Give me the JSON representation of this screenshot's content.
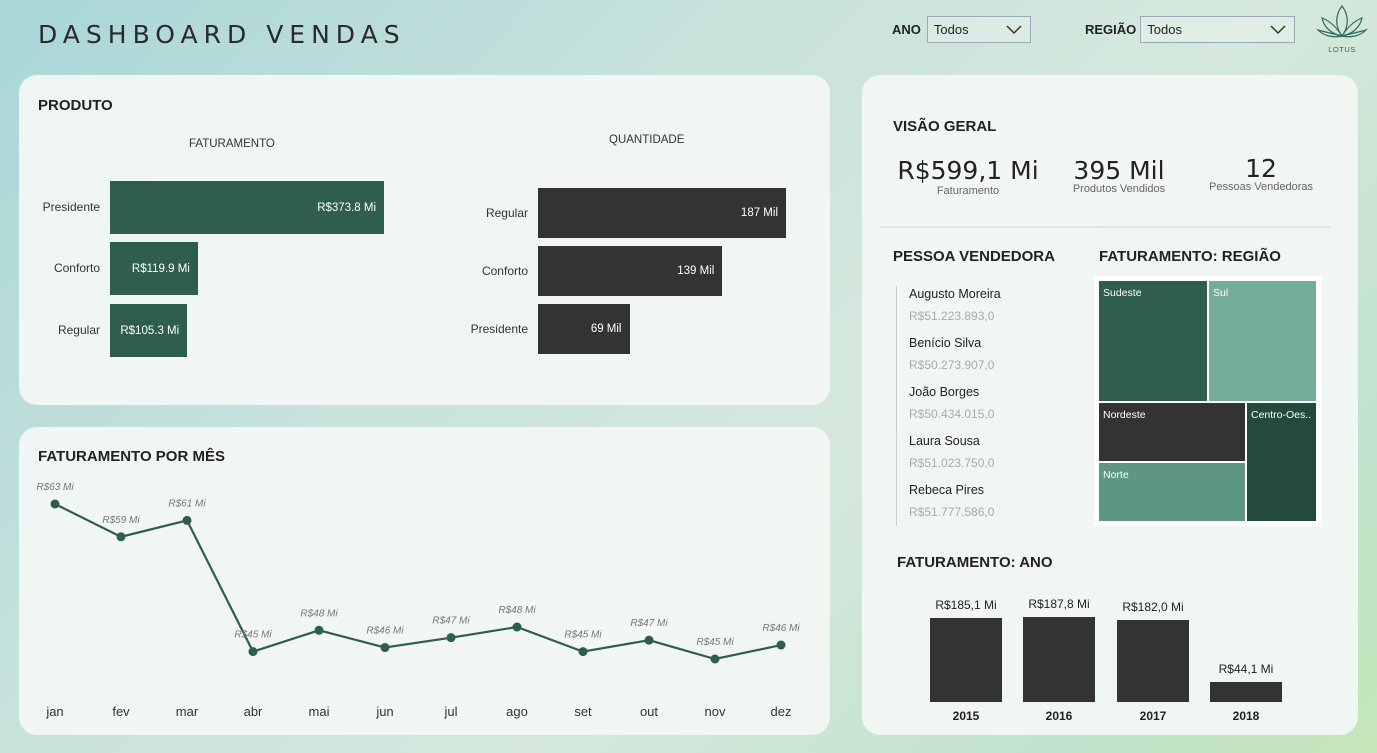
{
  "header": {
    "title": "DASHBOARD VENDAS",
    "filters": [
      {
        "label": "ANO",
        "value": "Todos"
      },
      {
        "label": "REGIÃO",
        "value": "Todos"
      }
    ],
    "logo_text": "LOTUS"
  },
  "produto": {
    "title": "PRODUTO",
    "faturamento": {
      "subtitle": "FATURAMENTO",
      "items": [
        {
          "label": "Presidente",
          "value": 373.8,
          "text": "R$373.8 Mi"
        },
        {
          "label": "Conforto",
          "value": 119.9,
          "text": "R$119.9 Mi"
        },
        {
          "label": "Regular",
          "value": 105.3,
          "text": "R$105.3 Mi"
        }
      ]
    },
    "quantidade": {
      "subtitle": "QUANTIDADE",
      "items": [
        {
          "label": "Regular",
          "value": 187,
          "text": "187 Mil"
        },
        {
          "label": "Conforto",
          "value": 139,
          "text": "139 Mil"
        },
        {
          "label": "Presidente",
          "value": 69,
          "text": "69 Mil"
        }
      ]
    }
  },
  "mes": {
    "title": "FATURAMENTO POR MÊS",
    "chart_data": {
      "type": "line",
      "categories": [
        "jan",
        "fev",
        "mar",
        "abr",
        "mai",
        "jun",
        "jul",
        "ago",
        "set",
        "out",
        "nov",
        "dez"
      ],
      "values": [
        63,
        59,
        61,
        45,
        48,
        46,
        47,
        48,
        45,
        47,
        45,
        46
      ],
      "data_labels": [
        "R$63 Mi",
        "R$59 Mi",
        "R$61 Mi",
        "R$45 Mi",
        "R$48 Mi",
        "R$46 Mi",
        "R$47 Mi",
        "R$48 Mi",
        "R$45 Mi",
        "R$47 Mi",
        "R$45 Mi",
        "R$46 Mi"
      ],
      "fine_values": [
        63.6,
        59.6,
        61.6,
        45.6,
        48.2,
        46.1,
        47.3,
        48.6,
        45.6,
        47.0,
        44.7,
        46.4
      ]
    }
  },
  "visao": {
    "title": "VISÃO GERAL",
    "kpis": [
      {
        "value": "R$599,1 Mi",
        "label": "Faturamento"
      },
      {
        "value": "395 Mil",
        "label": "Produtos Vendidos"
      },
      {
        "value": "12",
        "label": "Pessoas Vendedoras"
      }
    ]
  },
  "vendedora": {
    "title": "PESSOA VENDEDORA",
    "items": [
      {
        "name": "Augusto Moreira",
        "value": "R$51.223.893,0"
      },
      {
        "name": "Benício Silva",
        "value": "R$50.273.907,0"
      },
      {
        "name": "João Borges",
        "value": "R$50.434.015,0"
      },
      {
        "name": "Laura Sousa",
        "value": "R$51.023.750,0"
      },
      {
        "name": "Rebeca Pires",
        "value": "R$51.777.586,0"
      }
    ]
  },
  "regiao": {
    "title": "FATURAMENTO: REGIÃO",
    "tiles": [
      {
        "label": "Sudeste",
        "color": "#2f5e4e"
      },
      {
        "label": "Sul",
        "color": "#74ad9a"
      },
      {
        "label": "Nordeste",
        "color": "#333333"
      },
      {
        "label": "Centro-Oes..",
        "color": "#234a3d"
      },
      {
        "label": "Norte",
        "color": "#5e9684"
      }
    ]
  },
  "ano": {
    "title": "FATURAMENTO: ANO",
    "chart_data": {
      "type": "bar",
      "categories": [
        "2015",
        "2016",
        "2017",
        "2018"
      ],
      "values": [
        185.1,
        187.8,
        182.0,
        44.1
      ],
      "data_labels": [
        "R$185,1 Mi",
        "R$187,8 Mi",
        "R$182,0 Mi",
        "R$44,1 Mi"
      ]
    }
  }
}
